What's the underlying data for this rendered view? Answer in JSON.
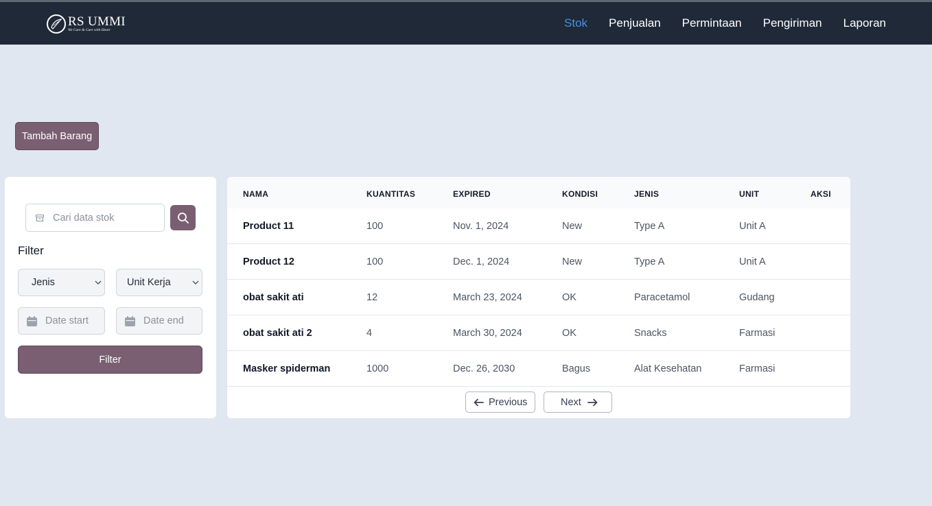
{
  "brand": {
    "name": "RS UMMI",
    "tagline": "We Care & Cure with Heart"
  },
  "nav": [
    {
      "label": "Stok",
      "active": true
    },
    {
      "label": "Penjualan",
      "active": false
    },
    {
      "label": "Permintaan",
      "active": false
    },
    {
      "label": "Pengiriman",
      "active": false
    },
    {
      "label": "Laporan",
      "active": false
    }
  ],
  "add_button": "Tambah Barang",
  "sidebar": {
    "search_placeholder": "Cari data stok",
    "filter_title": "Filter",
    "jenis_select": "Jenis",
    "unit_select": "Unit Kerja",
    "date_start_placeholder": "Date start",
    "date_end_placeholder": "Date end",
    "filter_button": "Filter"
  },
  "table": {
    "headers": [
      "NAMA",
      "KUANTITAS",
      "EXPIRED",
      "KONDISI",
      "JENIS",
      "UNIT",
      "AKSI"
    ],
    "rows": [
      [
        "Product 11",
        "100",
        "Nov. 1, 2024",
        "New",
        "Type A",
        "Unit A"
      ],
      [
        "Product 12",
        "100",
        "Dec. 1, 2024",
        "New",
        "Type A",
        "Unit A"
      ],
      [
        "obat sakit ati",
        "12",
        "March 23, 2024",
        "OK",
        "Paracetamol",
        "Gudang"
      ],
      [
        "obat sakit ati 2",
        "4",
        "March 30, 2024",
        "OK",
        "Snacks",
        "Farmasi"
      ],
      [
        "Masker spiderman",
        "1000",
        "Dec. 26, 2030",
        "Bagus",
        "Alat Kesehatan",
        "Farmasi"
      ]
    ]
  },
  "pagination": {
    "previous": "Previous",
    "next": "Next"
  },
  "colors": {
    "navbar": "#1f2937",
    "nav_active": "#4a90e2",
    "primary_button": "#7a5f72",
    "page_background": "#e1e7f0"
  }
}
